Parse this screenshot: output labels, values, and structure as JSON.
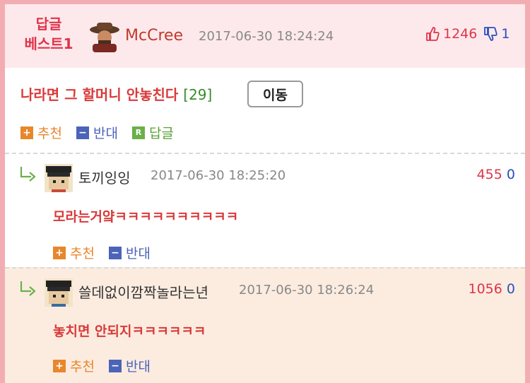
{
  "best": {
    "label_line1": "답글",
    "label_line2": "베스트1",
    "author": "McCree",
    "timestamp": "2017-06-30 18:24:24",
    "likes": "1246",
    "dislikes": "1"
  },
  "post": {
    "title": "나라면 그 할머니 안놓친다",
    "comment_count": "[29]",
    "move_label": "이동"
  },
  "actions": {
    "recommend": "추천",
    "oppose": "반대",
    "reply": "답글"
  },
  "replies": [
    {
      "author": "토끼잉잉",
      "timestamp": "2017-06-30 18:25:20",
      "likes": "455",
      "dislikes": "0",
      "text": "모라는거얔ㅋㅋㅋㅋㅋㅋㅋㅋㅋㅋ"
    },
    {
      "author": "쓸데없이깜짝놀라는년",
      "timestamp": "2017-06-30 18:26:24",
      "likes": "1056",
      "dislikes": "0",
      "text": "놓치면 안되지ㅋㅋㅋㅋㅋㅋ"
    }
  ],
  "colors": {
    "frame": "#f2adb3",
    "best_bg": "#fde9ec",
    "reply2_bg": "#fcece0",
    "accent_red": "#e0344a",
    "recommend": "#e8862c",
    "oppose": "#4b63b8",
    "reply": "#6bb04a"
  },
  "icons": [
    "thumbs-up-icon",
    "thumbs-down-icon",
    "plus-icon",
    "minus-icon",
    "reply-badge-icon",
    "reply-arrow-icon",
    "avatar"
  ]
}
